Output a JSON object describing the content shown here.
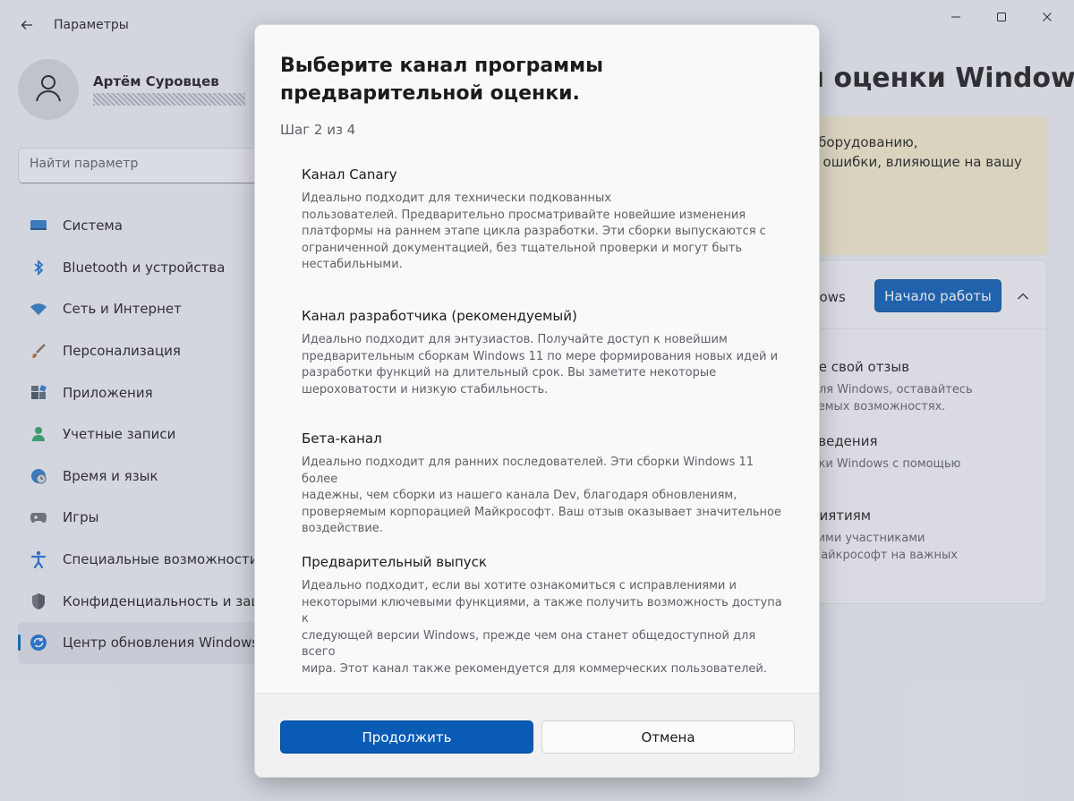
{
  "window": {
    "app_title": "Параметры",
    "page_heading": "й оценки Windows"
  },
  "profile": {
    "name": "Артём Суровцев"
  },
  "search": {
    "placeholder": "Найти параметр"
  },
  "sidebar": {
    "items": [
      {
        "label": "Система",
        "icon": "system-icon",
        "color": "#2b7ac8"
      },
      {
        "label": "Bluetooth и устройства",
        "icon": "bluetooth-icon",
        "color": "#1a6fd1"
      },
      {
        "label": "Сеть и Интернет",
        "icon": "wifi-icon",
        "color": "#2b7ac8"
      },
      {
        "label": "Персонализация",
        "icon": "brush-icon",
        "color": "#c36a3c"
      },
      {
        "label": "Приложения",
        "icon": "apps-icon",
        "color": "#46525f"
      },
      {
        "label": "Учетные записи",
        "icon": "account-icon",
        "color": "#2ea36a"
      },
      {
        "label": "Время и язык",
        "icon": "globe-icon",
        "color": "#2b7ac8"
      },
      {
        "label": "Игры",
        "icon": "gamepad-icon",
        "color": "#6a6f78"
      },
      {
        "label": "Специальные возможности",
        "icon": "accessibility-icon",
        "color": "#1a6fd1"
      },
      {
        "label": "Конфиденциальность и защита",
        "icon": "shield-icon",
        "color": "#6a6f78"
      },
      {
        "label": "Центр обновления Windows",
        "icon": "update-icon",
        "color": "#1a6fd1"
      }
    ],
    "active_index": 10
  },
  "background": {
    "warning_line1": "оборудованию,",
    "warning_line2": "и ошибки, влияющие на вашу",
    "join_text": "dows",
    "start_button": "Начало работы",
    "info": [
      {
        "title": "те свой отзыв",
        "line1": "для Windows, оставайтесь",
        "line2": "уемых возможностях."
      },
      {
        "title": "сведения",
        "line1": "нки Windows с помощью",
        "line2": ""
      },
      {
        "title": "риятиям",
        "line1": "тими участниками",
        "line2": "Майкрософт на важных"
      }
    ]
  },
  "dialog": {
    "title": "Выберите канал программы предварительной оценки.",
    "step": "Шаг 2 из 4",
    "channels": [
      {
        "title": "Канал Canary",
        "lines": [
          "Идеально подходит для технически подкованных",
          "пользователей. Предварительно просматривайте новейшие изменения",
          "платформы на раннем этапе цикла разработки. Эти сборки выпускаются с",
          "ограниченной документацией, без тщательной проверки и могут быть",
          "нестабильными."
        ]
      },
      {
        "title": "Канал разработчика (рекомендуемый)",
        "lines": [
          "Идеально подходит для энтузиастов. Получайте доступ к новейшим",
          "предварительным сборкам Windows 11 по мере формирования новых идей и",
          "разработки функций на длительный срок. Вы заметите некоторые",
          "шероховатости и низкую стабильность."
        ]
      },
      {
        "title": "Бета-канал",
        "lines": [
          "Идеально подходит для ранних последователей. Эти сборки Windows 11 более",
          "надежны, чем сборки из нашего канала Dev, благодаря обновлениям,",
          "проверяемым корпорацией Майкрософт. Ваш отзыв оказывает значительное",
          "воздействие."
        ]
      },
      {
        "title": "Предварительный выпуск",
        "lines": [
          "Идеально подходит, если вы хотите ознакомиться с исправлениями и",
          "некоторыми ключевыми функциями, а также получить возможность доступа к",
          "следующей версии Windows, прежде чем она станет общедоступной для всего",
          "мира. Этот канал также рекомендуется для коммерческих пользователей."
        ]
      }
    ],
    "continue_button": "Продолжить",
    "cancel_button": "Отмена"
  },
  "colors": {
    "accent": "#0a5bb5",
    "warning_bg": "#f6eecd"
  }
}
